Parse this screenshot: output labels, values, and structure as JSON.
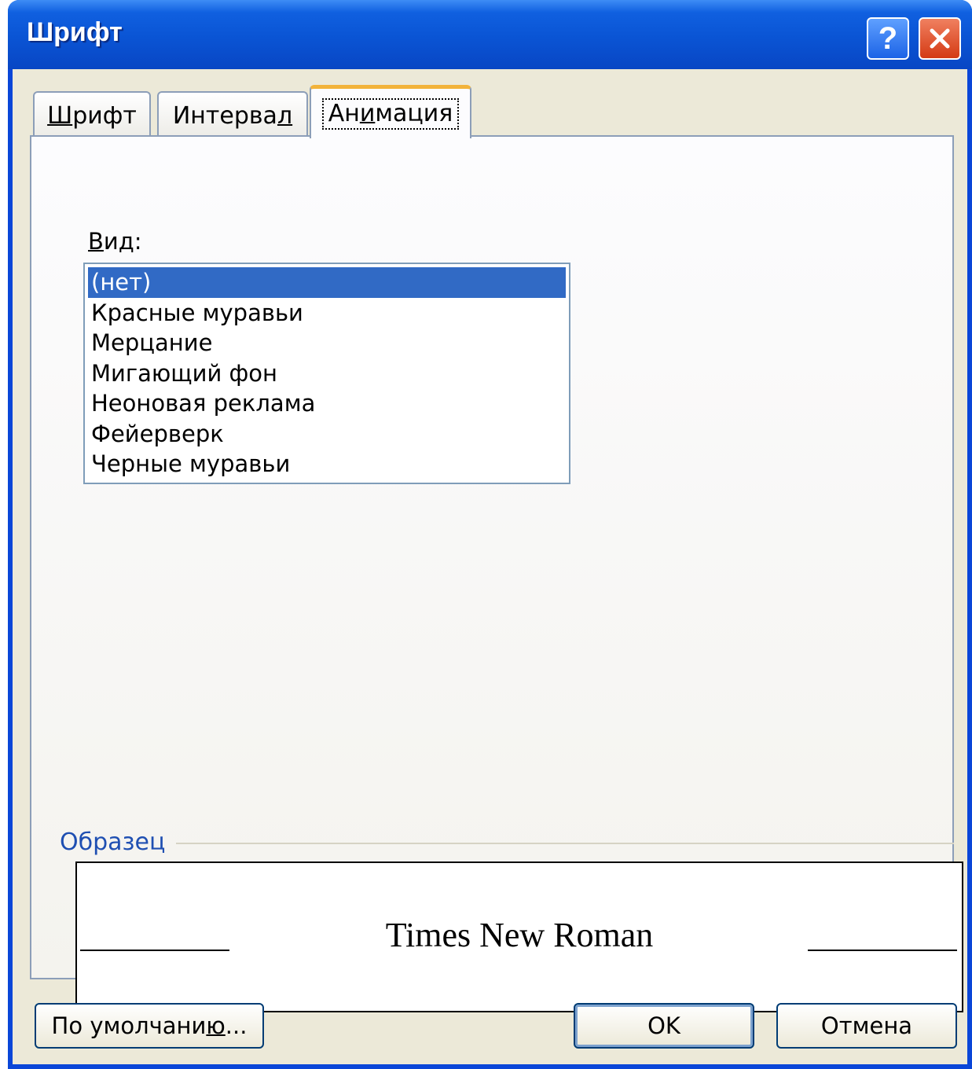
{
  "window": {
    "title": "Шрифт"
  },
  "titlebar_buttons": {
    "help": "?",
    "help_icon": "help-icon",
    "close_icon": "close-icon"
  },
  "tabs": [
    {
      "label": "Шрифт",
      "hotkey_index": 0,
      "active": false
    },
    {
      "label": "Интервал",
      "hotkey_index": 7,
      "active": false
    },
    {
      "label": "Анимация",
      "hotkey_index": 2,
      "active": true
    }
  ],
  "animation": {
    "label": "Вид:",
    "items": [
      "(нет)",
      "Красные муравьи",
      "Мерцание",
      "Мигающий фон",
      "Неоновая реклама",
      "Фейерверк",
      "Черные муравьи"
    ],
    "selected_index": 0
  },
  "sample": {
    "label": "Образец",
    "preview_text": "Times New Roman"
  },
  "buttons": {
    "default": "По умолчанию...",
    "ok": "OK",
    "cancel": "Отмена"
  },
  "colors": {
    "titlebar": "#0a54d4",
    "selection": "#316ac5",
    "active_tab_accent": "#f2b33a",
    "group_label": "#1f4fb2"
  }
}
